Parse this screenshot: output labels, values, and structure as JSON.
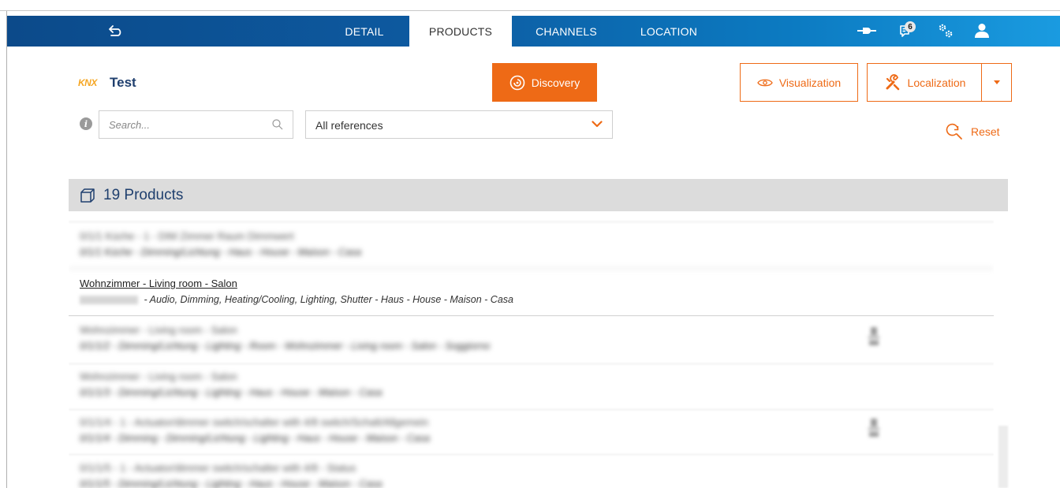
{
  "nav": {
    "tabs": [
      {
        "label": "DETAIL",
        "active": false
      },
      {
        "label": "PRODUCTS",
        "active": true
      },
      {
        "label": "CHANNELS",
        "active": false
      },
      {
        "label": "LOCATION",
        "active": false
      }
    ],
    "notification_count": "6",
    "icons": [
      "back-arrow-icon",
      "connection-plug-icon",
      "notifications-icon",
      "settings-gears-icon",
      "user-icon"
    ]
  },
  "header": {
    "logo_text": "KNX",
    "project_title": "Test",
    "discovery_label": "Discovery",
    "visualization_label": "Visualization",
    "localization_label": "Localization"
  },
  "filters": {
    "search_placeholder": "Search...",
    "search_value": "",
    "references_selected": "All references",
    "reset_label": "Reset"
  },
  "products": {
    "count_label": "19 Products",
    "items": [
      {
        "title": "0/1/1 Küche - 1 - DIM Zimmer Raum Dimmwert",
        "subtitle": "0/1/1 Küche - Dimming/Lichtung - Haus - House - Maison - Casa",
        "blurred": true
      },
      {
        "title": "Wohnzimmer - Living room - Salon",
        "subtitle": " - Audio, Dimming, Heating/Cooling, Lighting, Shutter - Haus - House - Maison - Casa",
        "blurred": false
      },
      {
        "title": "Wohnzimmer - Living room - Salon",
        "subtitle": "0/1/1/2 - Dimming/Lichtung - Lighting - Room - Wohnzimmer - Living room - Salon - Soggiorno",
        "blurred": true
      },
      {
        "title": "Wohnzimmer - Living room - Salon",
        "subtitle": "0/1/1/3 - Dimming/Lichtung - Lighting - Haus - House - Maison - Casa",
        "blurred": true
      },
      {
        "title": "0/1/1/4 - 1 - Actuator/dimmer switch/schalter with 4/8 switch/Schalt/Allgemein",
        "subtitle": "0/1/1/4 - Dimming - Dimming/Lichtung - Lighting - Haus - House - Maison - Casa",
        "blurred": true
      },
      {
        "title": "0/1/1/5 - 1 - Actuator/dimmer switch/schalter with 4/8 - Status",
        "subtitle": "0/1/1/5 - Dimming/Lichtung - Lighting - Haus - House - Maison - Casa",
        "blurred": true
      }
    ]
  },
  "colors": {
    "accent_orange": "#ee6a16",
    "nav_blue_start": "#0c4a8a",
    "nav_blue_end": "#1a9be0",
    "title_blue": "#1f3f6e"
  }
}
